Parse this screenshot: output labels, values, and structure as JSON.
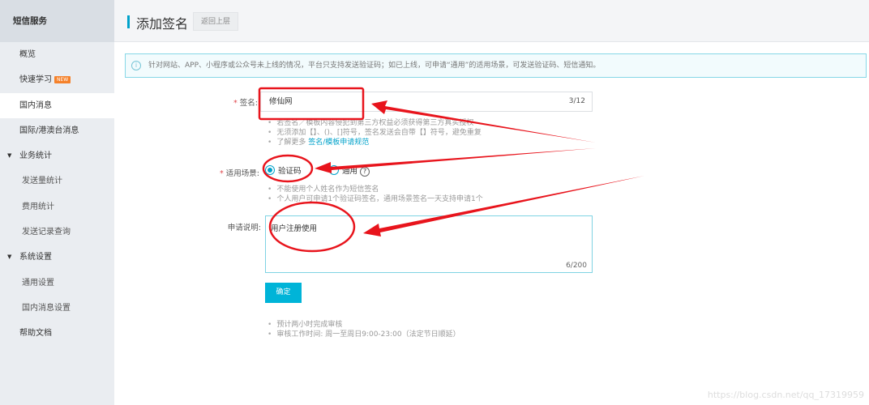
{
  "sidebar": {
    "title": "短信服务",
    "items": [
      {
        "label": "概览"
      },
      {
        "label": "快速学习",
        "badge": "NEW"
      },
      {
        "label": "国内消息"
      },
      {
        "label": "国际/港澳台消息"
      },
      {
        "label": "业务统计"
      },
      {
        "label": "发送量统计"
      },
      {
        "label": "费用统计"
      },
      {
        "label": "发送记录查询"
      },
      {
        "label": "系统设置"
      },
      {
        "label": "通用设置"
      },
      {
        "label": "国内消息设置"
      },
      {
        "label": "帮助文档"
      }
    ]
  },
  "header": {
    "title": "添加签名",
    "back_label": "返回上层"
  },
  "notice": {
    "text": "针对网站、APP、小程序或公众号未上线的情况，平台只支持发送验证码；如已上线，可申请“通用”的适用场景，可发送验证码、短信通知。"
  },
  "form": {
    "signature": {
      "label": "签名",
      "value": "修仙网",
      "count": "3/12",
      "hints": [
        "若签名／模板内容侵犯到第三方权益必须获得第三方真实授权",
        "无须添加【】、()、[]符号，签名发送会自带【】符号，避免重复"
      ],
      "more_prefix": "了解更多",
      "more_link": "签名/模板申请规范"
    },
    "scene": {
      "label": "适用场景",
      "options": [
        "验证码",
        "通用"
      ],
      "selected": "验证码",
      "hints": [
        "不能使用个人姓名作为短信签名",
        "个人用户可申请1个验证码签名，通用场景签名一天支持申请1个"
      ]
    },
    "description": {
      "label": "申请说明",
      "value": "用户注册使用",
      "count": "6/200"
    },
    "submit_label": "确定",
    "footer_hints": [
      "预计两小时完成审核",
      "审核工作时间: 周一至周日9:00-23:00（法定节日顺延）"
    ]
  },
  "watermark": "https://blog.csdn.net/qq_17319959"
}
